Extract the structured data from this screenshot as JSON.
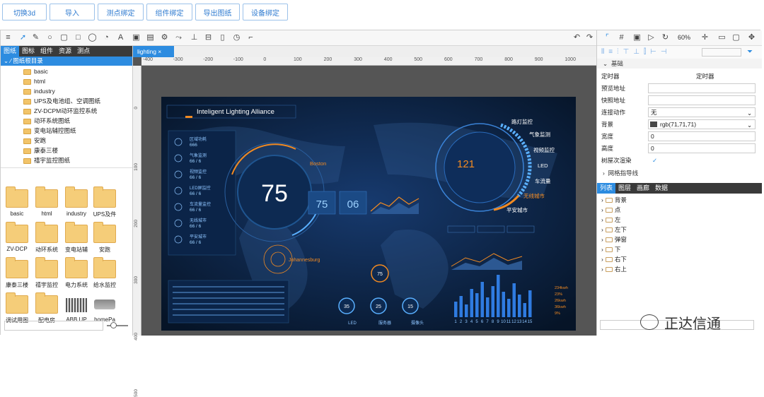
{
  "top_buttons": [
    "切换3d",
    "导入",
    "测点绑定",
    "组件绑定",
    "导出图纸",
    "设备绑定"
  ],
  "toolbar": {
    "zoom": "60%"
  },
  "left": {
    "tabs": [
      "图纸",
      "图标",
      "组件",
      "资源",
      "测点"
    ],
    "root": "图纸根目录",
    "folders": [
      "basic",
      "html",
      "industry",
      "UPS及电池组、空调图纸",
      "ZV-DCPM动环监控系统",
      "动环系统图纸",
      "变电站辅控图纸",
      "安跑",
      "康泰三楼",
      "禧宇监控图纸"
    ],
    "thumbs": [
      "basic",
      "html",
      "industry",
      "UPS及件",
      "ZV-DCP",
      "动环系统",
      "变电站辅",
      "安跑",
      "康泰三楼",
      "禧宇监控",
      "电力系统",
      "给水监控",
      "调试用图",
      "配电房",
      "ABB UP",
      "homePa"
    ]
  },
  "canvas": {
    "tab": "lighting",
    "ruler_h": [
      "-400",
      "-300",
      "-200",
      "-100",
      "0",
      "100",
      "200",
      "300",
      "400",
      "500",
      "600",
      "700",
      "800",
      "900",
      "1000"
    ],
    "ruler_v": [
      "0",
      "100",
      "200",
      "300",
      "400",
      "500"
    ]
  },
  "dashboard": {
    "title": "Inteligent Lighting Alliance",
    "big_number": "75",
    "city1": "Boston",
    "city2": "Johannesburg",
    "stats": [
      "75",
      "06"
    ],
    "counter": "121",
    "ring_labels": [
      "路灯监控",
      "气象监测",
      "视频监控",
      "LED",
      "车流量",
      "无线城市",
      "平安城市"
    ],
    "bottom_gauges": [
      "35",
      "25",
      "15"
    ],
    "top_gauge": "75",
    "left_items": [
      "区域功耗",
      "气象监测",
      "视频监控",
      "LED屏监控",
      "车流量监控",
      "无线城市",
      "平安城市"
    ],
    "left_values": [
      "666",
      "66 / 6",
      "66 / 6",
      "66 / 6",
      "66 / 6",
      "66 / 6",
      "66 / 6"
    ],
    "bar_xlabels": [
      "1",
      "2",
      "3",
      "4",
      "5",
      "6",
      "7",
      "8",
      "9",
      "10",
      "11",
      "12",
      "13",
      "14",
      "15"
    ],
    "bottom_labels": [
      "LED",
      "服务器",
      "摄像头"
    ],
    "right_stats": [
      "234kwh",
      "23%",
      "26kwh",
      "36kwh",
      "9%"
    ]
  },
  "right": {
    "section": "基础",
    "rows": [
      {
        "label": "定时器",
        "value": "定时器"
      },
      {
        "label": "预览地址",
        "value": ""
      },
      {
        "label": "快照地址",
        "value": ""
      },
      {
        "label": "连接动作",
        "value": "无"
      },
      {
        "label": "背景",
        "value": "rgb(71,71,71)"
      },
      {
        "label": "宽度",
        "value": "0"
      },
      {
        "label": "高度",
        "value": "0"
      },
      {
        "label": "树屋次渲染",
        "value": "✓"
      }
    ],
    "grid_section": "网格指导线",
    "tabs": [
      "列表",
      "图层",
      "画廊",
      "数据"
    ],
    "layers": [
      "背景",
      "点",
      "左",
      "左下",
      "弹窗",
      "下",
      "右下",
      "右上"
    ]
  },
  "watermark": "正达信通"
}
